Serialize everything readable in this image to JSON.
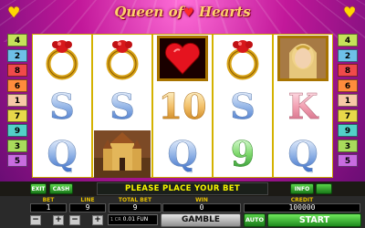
{
  "title": {
    "text": "Queen",
    "heart": "♥",
    "text2": "Hearts",
    "of": "of"
  },
  "line_tags_left": [
    "4",
    "2",
    "8",
    "6",
    "1",
    "7",
    "9",
    "3",
    "5"
  ],
  "line_tags_right": [
    "4",
    "2",
    "8",
    "6",
    "1",
    "7",
    "9",
    "3",
    "5"
  ],
  "line_colors": {
    "1": "#f7c8a6",
    "2": "#6ec0e8",
    "3": "#a9dc5c",
    "4": "#c5e25a",
    "5": "#c86be0",
    "6": "#ff8c3c",
    "7": "#e8d84a",
    "8": "#ef4a4a",
    "9": "#52d0c8"
  },
  "reels": [
    [
      "ring",
      "S",
      "Q"
    ],
    [
      "ring",
      "S",
      "castle"
    ],
    [
      "heart",
      "10",
      "Q"
    ],
    [
      "ring",
      "S",
      "9"
    ],
    [
      "queen",
      "K",
      "Q"
    ]
  ],
  "buttons": {
    "exit": "EXIT",
    "cash": "CASH",
    "info": "INFO",
    "gamble": "GAMBLE",
    "auto": "AUTO",
    "start": "START"
  },
  "message": "PLEASE PLACE YOUR BET",
  "stats": {
    "bet_label": "BET",
    "bet_value": "1",
    "line_label": "LINE",
    "line_value": "9",
    "total_bet_label": "TOTAL BET",
    "total_bet_value": "9",
    "win_label": "WIN",
    "win_value": "0",
    "credit_label": "CREDIT",
    "credit_value": "100000"
  },
  "denomination": "0.01 FUN",
  "denom_prefix": "1 CR"
}
